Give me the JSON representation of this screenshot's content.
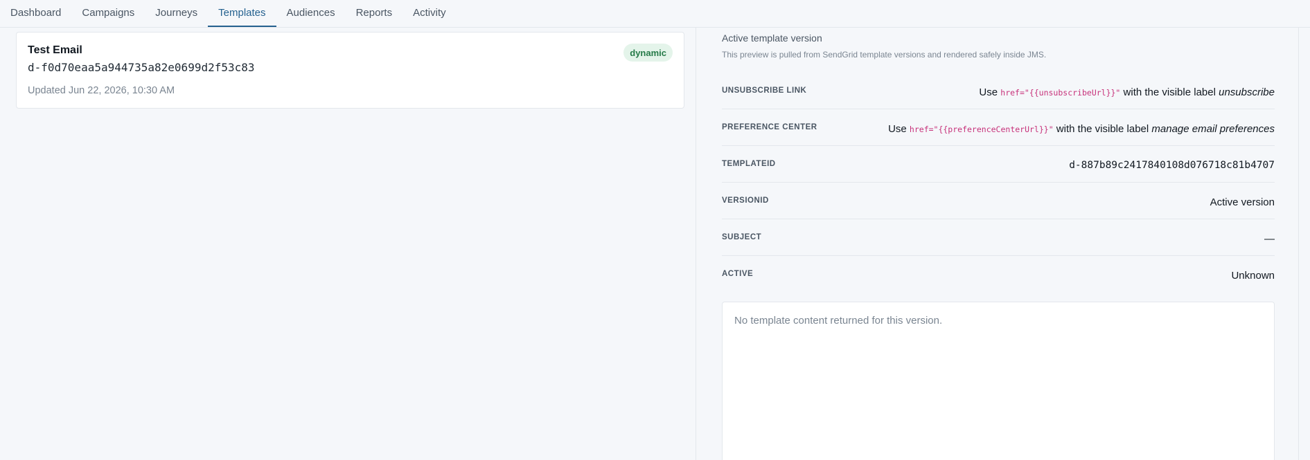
{
  "nav": {
    "tabs": [
      {
        "label": "Dashboard",
        "active": false
      },
      {
        "label": "Campaigns",
        "active": false
      },
      {
        "label": "Journeys",
        "active": false
      },
      {
        "label": "Templates",
        "active": true
      },
      {
        "label": "Audiences",
        "active": false
      },
      {
        "label": "Reports",
        "active": false
      },
      {
        "label": "Activity",
        "active": false
      }
    ]
  },
  "template_card": {
    "name": "Test Email",
    "id": "d-f0d70eaa5a944735a82e0699d2f53c83",
    "updated": "Updated Jun 22, 2026, 10:30 AM",
    "badge": "dynamic"
  },
  "detail": {
    "title": "Active template version",
    "subtitle": "This preview is pulled from SendGrid template versions and rendered safely inside JMS.",
    "unsubscribe": {
      "label": "UNSUBSCRIBE LINK",
      "prefix": "Use ",
      "code": "href=\"{{unsubscribeUrl}}\"",
      "middle": " with the visible label ",
      "emph": "unsubscribe"
    },
    "preference": {
      "label": "PREFERENCE CENTER",
      "prefix": "Use ",
      "code": "href=\"{{preferenceCenterUrl}}\"",
      "middle": " with the visible label ",
      "emph": "manage email preferences"
    },
    "template_id": {
      "label": "TEMPLATEID",
      "value": "d-887b89c2417840108d076718c81b4707"
    },
    "version_id": {
      "label": "VERSIONID",
      "value": "Active version"
    },
    "subject": {
      "label": "SUBJECT",
      "value": "—"
    },
    "active": {
      "label": "ACTIVE",
      "value": "Unknown"
    },
    "content_empty": "No template content returned for this version."
  },
  "colors": {
    "accent": "#24618f",
    "badge_bg": "#e4f4ea",
    "badge_text": "#257a48",
    "code": "#c7317a",
    "background": "#f5f7fa"
  }
}
